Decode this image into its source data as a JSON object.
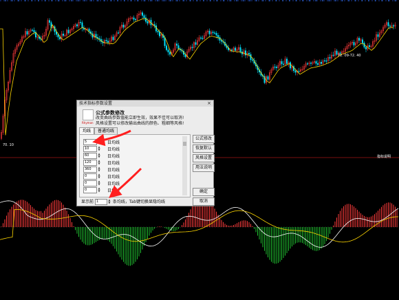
{
  "chart": {
    "main_label": "72. 09-72. 40",
    "low_label": "70. 10",
    "sub_label": "指标说明"
  },
  "dialog": {
    "title": "技术指标参数设置",
    "close": "×",
    "logo_text": "Rhymon",
    "header_title": "公式参数修改",
    "header_desc_1": "改变曲线参数值能立即生效，效果不佳可以取消!",
    "header_desc_2": "风格设置可以修改输出曲线的颜色、粗细等风格!",
    "tabs": [
      "均线",
      "普通均线"
    ],
    "params": [
      {
        "value": "5",
        "label": "日均线"
      },
      {
        "value": "10",
        "label": "日均线"
      },
      {
        "value": "60",
        "label": "日均线"
      },
      {
        "value": "120",
        "label": "日均线"
      },
      {
        "value": "360",
        "label": "日均线"
      },
      {
        "value": "0",
        "label": "日均线"
      },
      {
        "value": "0",
        "label": "日均线"
      },
      {
        "value": "0",
        "label": "日均线"
      }
    ],
    "display_label": "显示前",
    "display_value": "1",
    "display_suffix": "条均线，Tab键切换显隐均线",
    "buttons": [
      "公式修改",
      "恢复默认",
      "风格设置",
      "用法说明",
      "确定",
      "取消"
    ]
  },
  "colors": {
    "up": "#ff3b3b",
    "down": "#00e5ff",
    "line": "#ffffff",
    "ma": "#ffd700",
    "arrow": "#ff1f1f"
  }
}
